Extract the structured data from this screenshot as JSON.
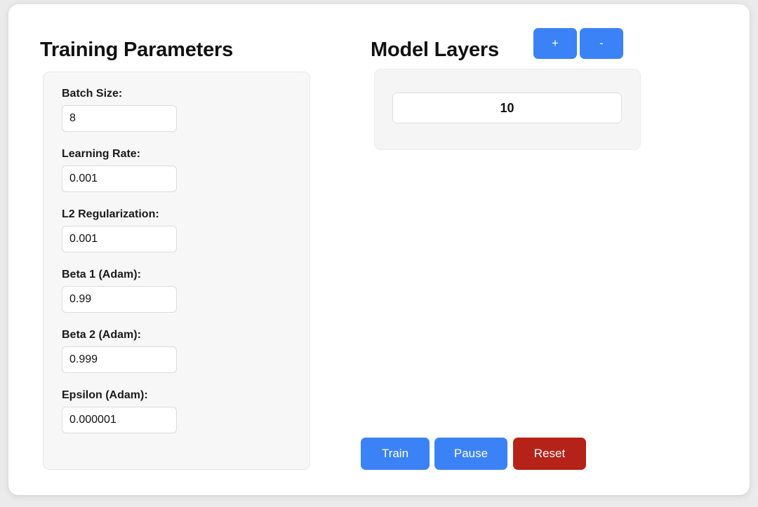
{
  "theme": {
    "page_background": "#ebebeb",
    "card_background": "#ffffff",
    "panel_background": "#f7f7f7",
    "accent_blue": "#3b82f6",
    "danger_red": "#b52217",
    "text_color": "#111111"
  },
  "training": {
    "title": "Training Parameters",
    "fields": [
      {
        "label": "Batch Size:",
        "value": "8",
        "placeholder": "Batch Size"
      },
      {
        "label": "Learning Rate:",
        "value": "0.001",
        "placeholder": "Learning Rate"
      },
      {
        "label": "L2 Regularization:",
        "value": "0.001",
        "placeholder": "L2 Regularization"
      },
      {
        "label": "Beta 1 (Adam):",
        "value": "0.99",
        "placeholder": "Beta 1"
      },
      {
        "label": "Beta 2 (Adam):",
        "value": "0.999",
        "placeholder": "Beta 2"
      },
      {
        "label": "Epsilon (Adam):",
        "value": "0.000001",
        "placeholder": "Epsilon"
      }
    ]
  },
  "layers": {
    "title": "Model Layers",
    "add_label": "+",
    "remove_label": "-",
    "count": "10"
  },
  "actions": {
    "train_label": "Train",
    "pause_label": "Pause",
    "reset_label": "Reset"
  }
}
